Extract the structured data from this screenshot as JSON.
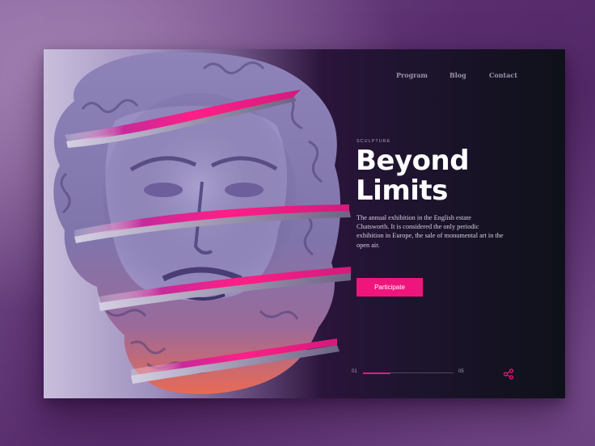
{
  "nav": {
    "items": [
      {
        "label": "Program"
      },
      {
        "label": "Blog"
      },
      {
        "label": "Contact"
      }
    ]
  },
  "hero": {
    "eyebrow": "SCULPTURE",
    "title_line1": "Beyond",
    "title_line2": "Limits",
    "description": "The annual exhibition in the English estate Chatsworth. It is considered the only periodic exhibition in Europe, the sale of monumental art in the open air.",
    "cta_label": "Participate"
  },
  "pager": {
    "current": "01",
    "total": "05",
    "progress": 0.3
  },
  "icons": {
    "share": "share-icon"
  },
  "colors": {
    "accent": "#f0157c",
    "sculpture": "#8a7fb3",
    "background": "#5a2e6e"
  }
}
